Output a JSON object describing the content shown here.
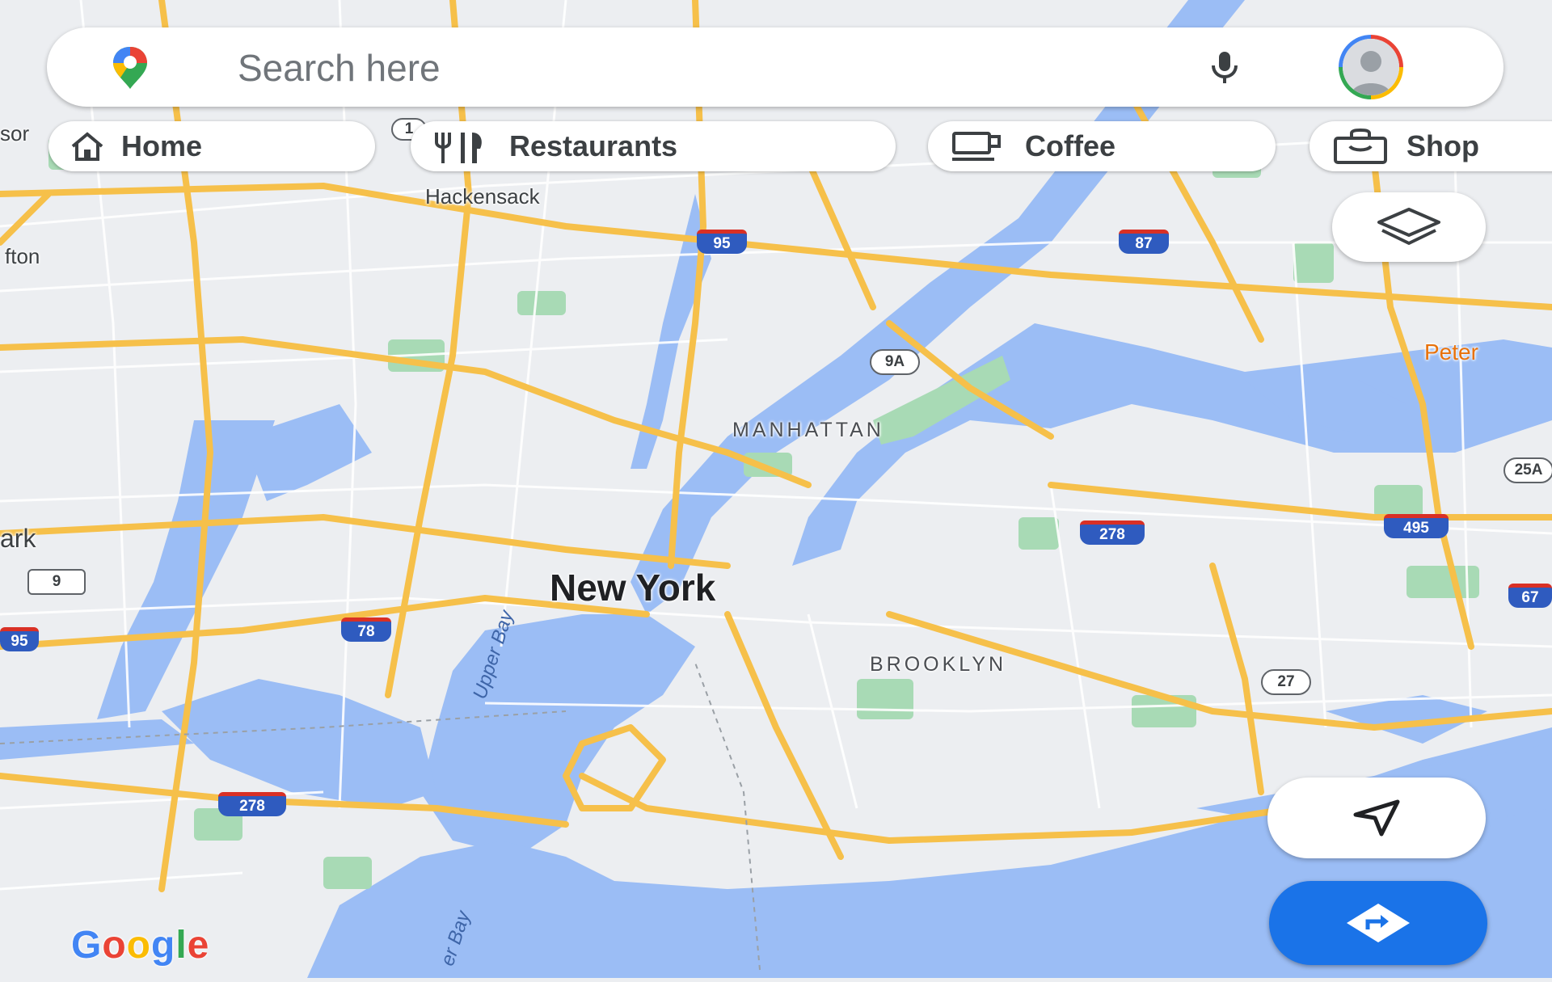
{
  "search": {
    "placeholder": "Search here"
  },
  "chips": [
    {
      "label": "Home",
      "icon": "home-icon"
    },
    {
      "label": "Restaurants",
      "icon": "restaurant-icon"
    },
    {
      "label": "Coffee",
      "icon": "coffee-icon"
    },
    {
      "label": "Shop",
      "icon": "shopping-bag-icon"
    }
  ],
  "map": {
    "places": {
      "hackensack": "Hackensack",
      "clifton": "fton",
      "newark": "ark",
      "manhattan": "MANHATTAN",
      "new_york": "New York",
      "brooklyn": "BROOKLYN",
      "upper_bay": "Upper Bay",
      "lower_bay": "er Bay",
      "peter": "Peter",
      "passaic": "sor"
    },
    "shields": {
      "i95_north": "95",
      "i87": "87",
      "r9a": "9A",
      "r25a": "25A",
      "i278_queens": "278",
      "i495": "495",
      "i9": "9",
      "i95_west": "95",
      "i78": "78",
      "i278_staten": "278",
      "r27": "27",
      "i678": "67",
      "r1": "1"
    }
  },
  "attribution": {
    "logo_letters": [
      "G",
      "o",
      "o",
      "g",
      "l",
      "e"
    ],
    "logo_colors": [
      "#4285f4",
      "#ea4335",
      "#fbbc04",
      "#4285f4",
      "#34a853",
      "#ea4335"
    ]
  },
  "colors": {
    "water": "#9bbdf5",
    "land": "#eceef1",
    "park": "#a8dab5",
    "highway": "#f6c04a",
    "accent": "#1a73e8"
  }
}
